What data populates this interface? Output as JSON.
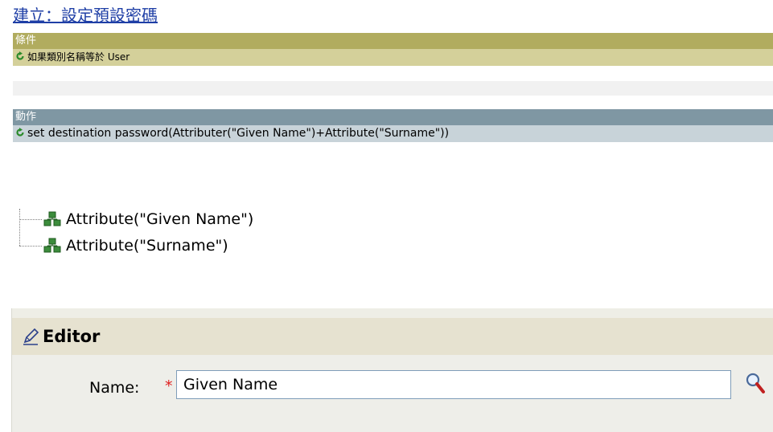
{
  "rule": {
    "title": "建立：設定預設密碼"
  },
  "conditions": {
    "header": "條件",
    "items": [
      {
        "icon": "refresh-icon",
        "text": "如果類別名稱等於 User"
      }
    ]
  },
  "actions": {
    "header": "動作",
    "items": [
      {
        "icon": "refresh-icon",
        "text": "set destination password(Attributer(\"Given Name\")+Attribute(\"Surname\"))"
      }
    ]
  },
  "tree": {
    "nodes": [
      {
        "icon": "attribute-icon",
        "label": "Attribute(\"Given Name\")"
      },
      {
        "icon": "attribute-icon",
        "label": "Attribute(\"Surname\")"
      }
    ]
  },
  "editor": {
    "icon": "pencil-icon",
    "title": "Editor",
    "name_label": "Name:",
    "required_mark": "*",
    "name_value": "Given Name",
    "search_icon": "magnifier-icon"
  },
  "colors": {
    "condition_header": "#b1ac5f",
    "condition_row": "#d4d09a",
    "action_header": "#7f97a3",
    "action_row": "#c8d3d9",
    "link": "#1f3fa6",
    "refresh_icon": "#2a8a2a"
  }
}
